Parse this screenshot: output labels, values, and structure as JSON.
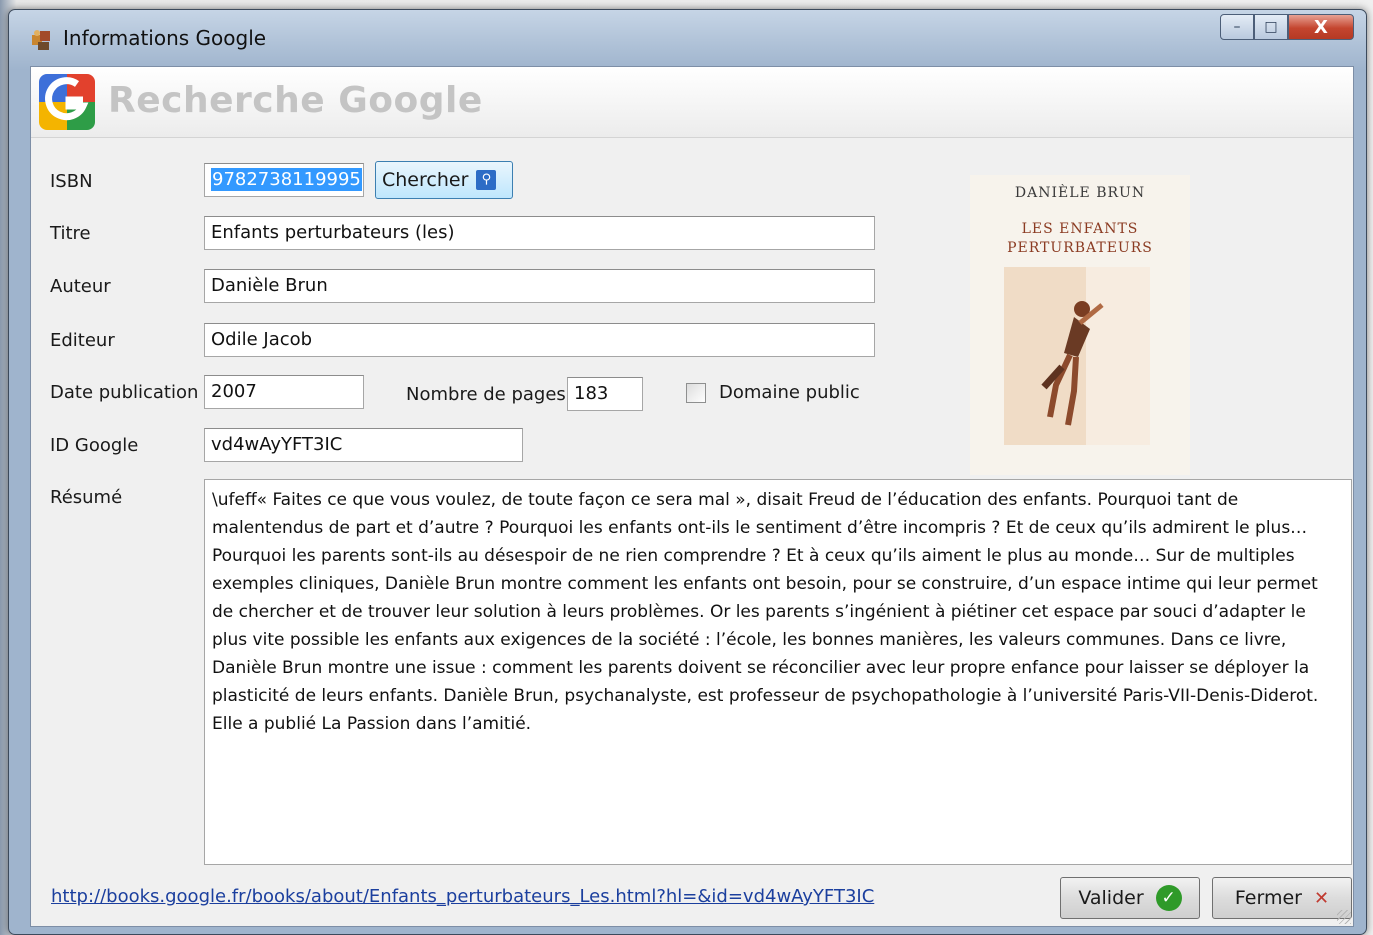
{
  "window": {
    "title": "Informations Google",
    "minimize": "–",
    "maximize": "□",
    "close": "X"
  },
  "header": {
    "title": "Recherche Google"
  },
  "labels": {
    "isbn": "ISBN",
    "titre": "Titre",
    "auteur": "Auteur",
    "editeur": "Editeur",
    "date_publication": "Date publication",
    "nombre_pages": "Nombre de pages",
    "domaine_public": "Domaine public",
    "id_google": "ID Google",
    "resume": "Résumé"
  },
  "fields": {
    "isbn": "9782738119995",
    "titre": "Enfants perturbateurs (les)",
    "auteur": "Danièle Brun",
    "editeur": "Odile Jacob",
    "date_publication": "2007",
    "nombre_pages": "183",
    "domaine_public_checked": false,
    "id_google": "vd4wAyYFT3IC",
    "resume": "\\ufeff« Faites ce que vous voulez, de toute façon ce sera mal », disait Freud de l’éducation des enfants. Pourquoi tant de malentendus de part et d’autre ? Pourquoi les enfants ont-ils le sentiment d’être incompris ? Et de ceux qu’ils admirent le plus… Pourquoi les parents sont-ils au désespoir de ne rien comprendre ? Et à ceux qu’ils aiment le plus au monde… Sur de multiples exemples cliniques, Danièle Brun montre comment les enfants ont besoin, pour se construire, d’un espace intime qui leur permet de chercher et de trouver leur solution à leurs problèmes. Or les parents s’ingénient à piétiner cet espace par souci d’adapter le plus vite possible les enfants aux exigences de la société : l’école, les bonnes manières, les valeurs communes. Dans ce livre, Danièle Brun montre une issue : comment les parents doivent se réconcilier avec leur propre enfance pour laisser se déployer la plasticité de leurs enfants. Danièle Brun, psychanalyste, est professeur de psychopathologie à l’université Paris-VII-Denis-Diderot. Elle a publié La Passion dans l’amitié."
  },
  "buttons": {
    "chercher": "Chercher",
    "valider": "Valider",
    "fermer": "Fermer"
  },
  "cover": {
    "author": "DANIÈLE BRUN",
    "title_line1": "LES ENFANTS",
    "title_line2": "PERTURBATEURS"
  },
  "link": "http://books.google.fr/books/about/Enfants_perturbateurs_Les.html?hl=&id=vd4wAyYFT3IC",
  "icons": {
    "app": "puzzle-icon",
    "search": "magnifier-icon",
    "valider": "green-check-icon",
    "fermer": "red-x-icon"
  },
  "colors": {
    "selection": "#3399ff",
    "link": "#1b3f9e",
    "header_title": "#c4c4c4",
    "close_button": "#c4452f"
  }
}
